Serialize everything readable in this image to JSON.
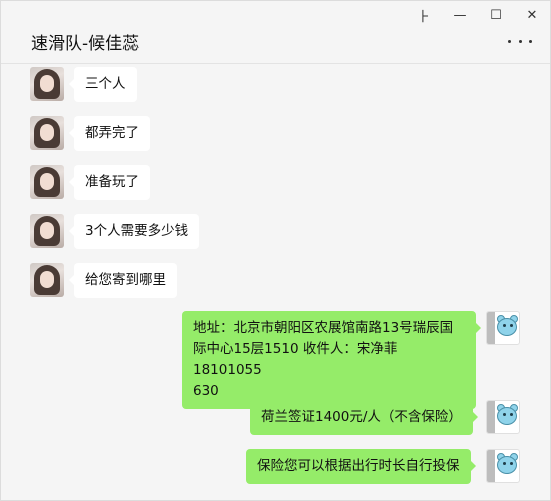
{
  "window": {
    "controls": {
      "pin": "⺊",
      "minimize": "—",
      "maximize": "☐",
      "close": "✕"
    }
  },
  "chat": {
    "title": "速滑队-候佳蕊",
    "more_icon": "more-dots-icon"
  },
  "messages": [
    {
      "side": "in",
      "text": "三个人"
    },
    {
      "side": "in",
      "text": "都弄完了"
    },
    {
      "side": "in",
      "text": "准备玩了"
    },
    {
      "side": "in",
      "text": "3个人需要多少钱"
    },
    {
      "side": "in",
      "text": "给您寄到哪里"
    },
    {
      "side": "out",
      "text_lines": [
        "地址：北京市朝阳区农展馆南路13号瑞辰国",
        "际中心15层1510 收件人：宋净菲 18101055",
        "630"
      ]
    },
    {
      "side": "out",
      "text": "荷兰签证1400元/人（不含保险）"
    },
    {
      "side": "out",
      "text": "保险您可以根据出行时长自行投保"
    }
  ],
  "colors": {
    "outgoing_bubble": "#95ec69",
    "incoming_bubble": "#ffffff",
    "background": "#f5f5f5"
  }
}
